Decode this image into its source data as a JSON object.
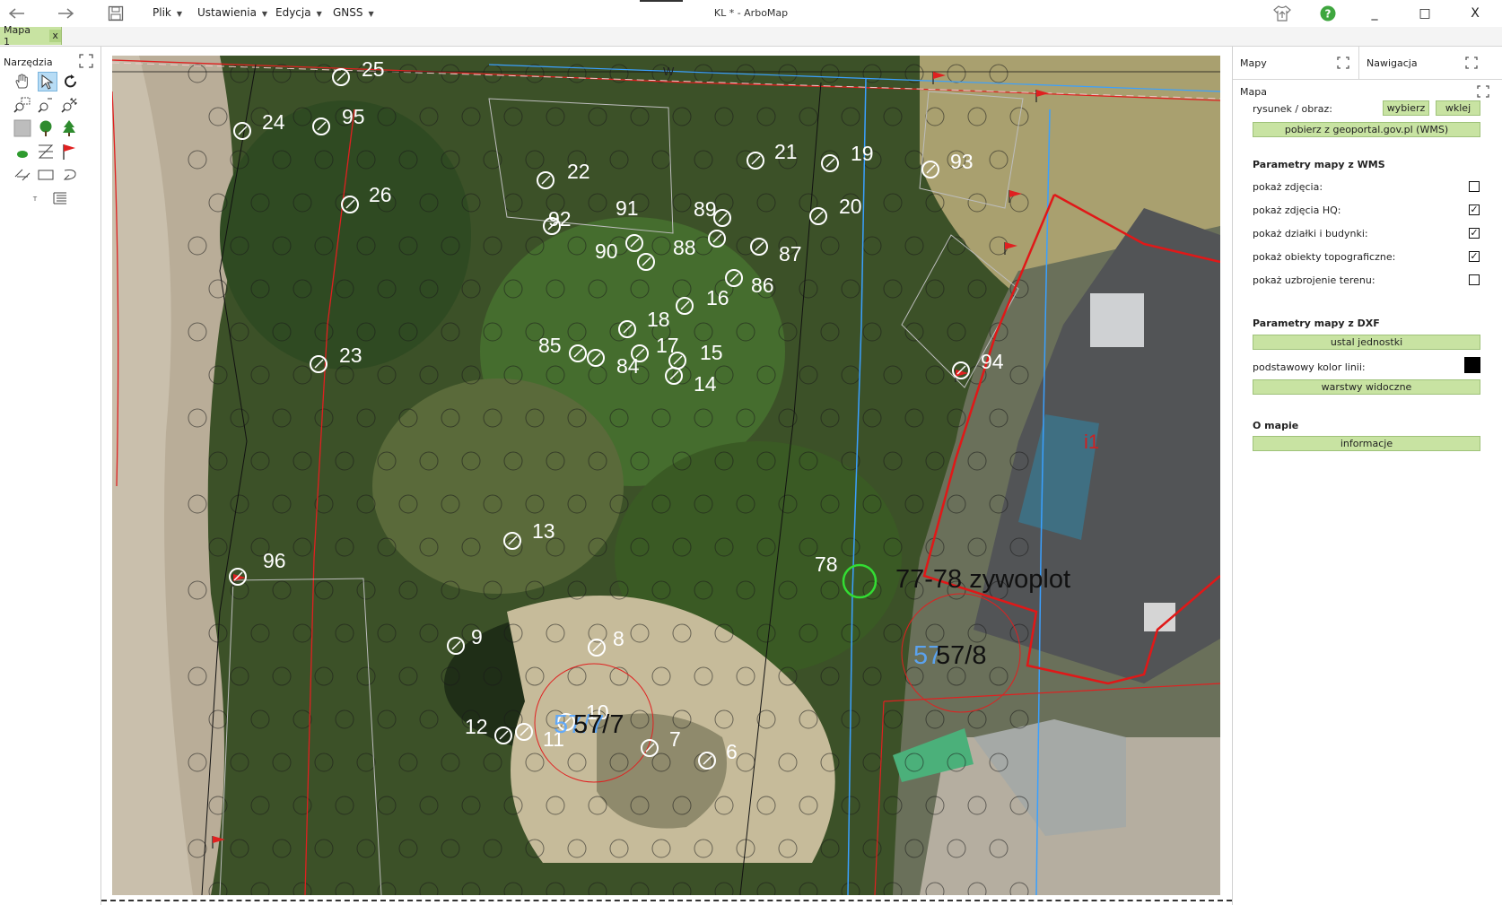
{
  "window": {
    "title": "KL * - ArboMap",
    "back_icon": "undo-arrow-icon",
    "forward_icon": "redo-arrow-icon",
    "save_icon": "floppy-disk-icon",
    "update_icon": "upload-shirt-icon",
    "help_icon": "help-circle-icon",
    "minimize": "_",
    "maximize": "□",
    "close": "X"
  },
  "menu": [
    {
      "label": "Plik"
    },
    {
      "label": "Ustawienia"
    },
    {
      "label": "Edycja"
    },
    {
      "label": "GNSS"
    }
  ],
  "tabs": [
    {
      "label": "Mapa 1",
      "close": "x"
    }
  ],
  "tools": {
    "title": "Narzędzia",
    "items": [
      "hand-pan-icon",
      "select-arrow-icon",
      "rotate-icon",
      "zoom-rect-icon",
      "zoom-out-icon",
      "zoom-extents-icon",
      "fill-area-icon",
      "deciduous-tree-icon",
      "conifer-tree-icon",
      "shrub-icon",
      "polyline-icon",
      "flag-icon",
      "measure-icon",
      "rectangle-icon",
      "lasso-icon",
      "text-tool-icon",
      "legend-icon"
    ]
  },
  "right_panel": {
    "tabs": [
      {
        "label": "Mapy"
      },
      {
        "label": "Nawigacja"
      }
    ],
    "map_section": {
      "title": "Mapa",
      "image_label": "rysunek / obraz:",
      "choose_button": "wybierz",
      "paste_button": "wklej",
      "geoportal_button": "pobierz z geoportal.gov.pl (WMS)"
    },
    "wms": {
      "title": "Parametry mapy z WMS",
      "options": [
        {
          "label": "pokaż zdjęcia:",
          "checked": false
        },
        {
          "label": "pokaż zdjęcia HQ:",
          "checked": true
        },
        {
          "label": "pokaż działki i budynki:",
          "checked": true
        },
        {
          "label": "pokaż obiekty topograficzne:",
          "checked": true
        },
        {
          "label": "pokaż uzbrojenie terenu:",
          "checked": false
        }
      ]
    },
    "dxf": {
      "title": "Parametry mapy z DXF",
      "units_button": "ustal jednostki",
      "line_color_label": "podstawowy kolor linii:",
      "line_color": "#000000",
      "layers_button": "warstwy widoczne"
    },
    "about": {
      "title": "O mapie",
      "info_button": "informacje"
    }
  },
  "map": {
    "trees": [
      "25",
      "24",
      "95",
      "26",
      "22",
      "21",
      "19",
      "20",
      "93",
      "91",
      "92",
      "90",
      "89",
      "88",
      "87",
      "86",
      "16",
      "18",
      "85",
      "84",
      "17",
      "15",
      "14",
      "23",
      "94",
      "13",
      "96",
      "78",
      "9",
      "8",
      "10",
      "12",
      "11",
      "7",
      "6"
    ],
    "hedge_label": "77-78 zywoplot",
    "parcel_labels": [
      "57/7",
      "57/8"
    ],
    "parcel_faded_labels": [
      "57/7",
      "57"
    ],
    "building_label": "i1",
    "road_label": "W",
    "colors": {
      "tree_marker": "#ffffff",
      "hedge_marker": "#33dd33",
      "parcel_line": "#e02020",
      "utility_line": "#3aa0ff"
    }
  }
}
